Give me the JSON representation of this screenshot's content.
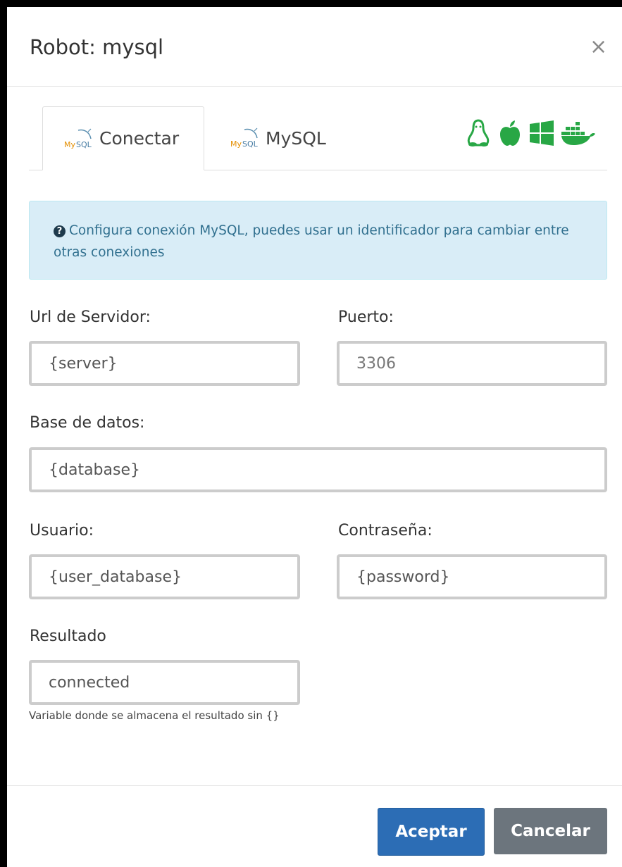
{
  "modal": {
    "title": "Robot: mysql",
    "close_symbol": "×"
  },
  "tabs": [
    {
      "label": "Conectar",
      "icon": "mysql-logo-icon",
      "active": true
    },
    {
      "label": "MySQL",
      "icon": "mysql-logo-icon",
      "active": false
    }
  ],
  "platform_icons": [
    "linux-icon",
    "apple-icon",
    "windows-icon",
    "docker-icon"
  ],
  "colors": {
    "platform_icons": "#28a745",
    "primary": "#2c6db5",
    "secondary": "#6c757d",
    "alert_bg": "#d9edf7"
  },
  "alert": {
    "icon": "question-circle-icon",
    "text": "Configura conexión MySQL, puedes usar un identificador para cambiar entre otras conexiones"
  },
  "form": {
    "server_label": "Url de Servidor:",
    "server_value": "{server}",
    "port_label": "Puerto:",
    "port_placeholder": "3306",
    "database_label": "Base de datos:",
    "database_value": "{database}",
    "user_label": "Usuario:",
    "user_value": "{user_database}",
    "password_label": "Contraseña:",
    "password_value": "{password}",
    "result_label": "Resultado",
    "result_value": "connected",
    "result_hint": "Variable donde se almacena el resultado sin {}"
  },
  "footer": {
    "accept_label": "Aceptar",
    "cancel_label": "Cancelar"
  }
}
